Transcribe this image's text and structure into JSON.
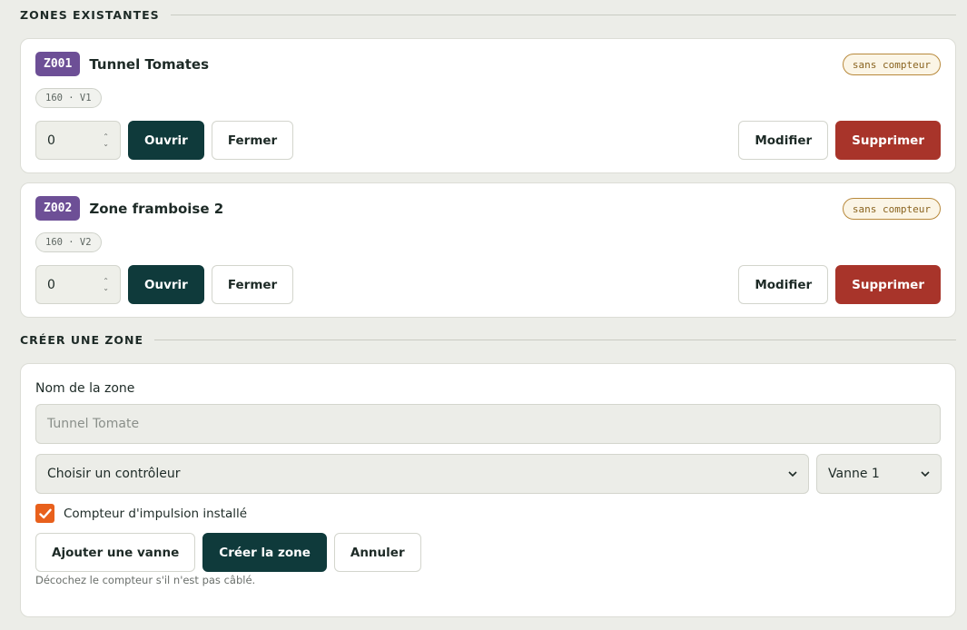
{
  "sections": {
    "existing_title": "ZONES EXISTANTES",
    "create_title": "CRÉER UNE ZONE"
  },
  "zones": [
    {
      "code": "Z001",
      "name": "Tunnel Tomates",
      "counter_badge": "sans compteur",
      "meta": "160 · V1",
      "duration_value": "0",
      "open_label": "Ouvrir",
      "close_label": "Fermer",
      "edit_label": "Modifier",
      "delete_label": "Supprimer"
    },
    {
      "code": "Z002",
      "name": "Zone framboise 2",
      "counter_badge": "sans compteur",
      "meta": "160 · V2",
      "duration_value": "0",
      "open_label": "Ouvrir",
      "close_label": "Fermer",
      "edit_label": "Modifier",
      "delete_label": "Supprimer"
    }
  ],
  "form": {
    "name_label": "Nom de la zone",
    "name_placeholder": "Tunnel Tomate",
    "controller_select": "Choisir un contrôleur",
    "valve_select": "Vanne 1",
    "counter_checkbox_label": "Compteur d'impulsion installé",
    "counter_checked": true,
    "add_valve_label": "Ajouter une vanne",
    "create_label": "Créer la zone",
    "cancel_label": "Annuler",
    "hint": "Décochez le compteur s'il n'est pas câblé."
  },
  "colors": {
    "background": "#ecede8",
    "primary": "#0f3a3b",
    "danger": "#a8342a",
    "code_badge": "#6d4f96",
    "checkbox": "#e8601c"
  },
  "icons": {
    "spinner": "spinner-arrows-icon",
    "select": "chevron-down-icon",
    "check": "check-icon"
  }
}
